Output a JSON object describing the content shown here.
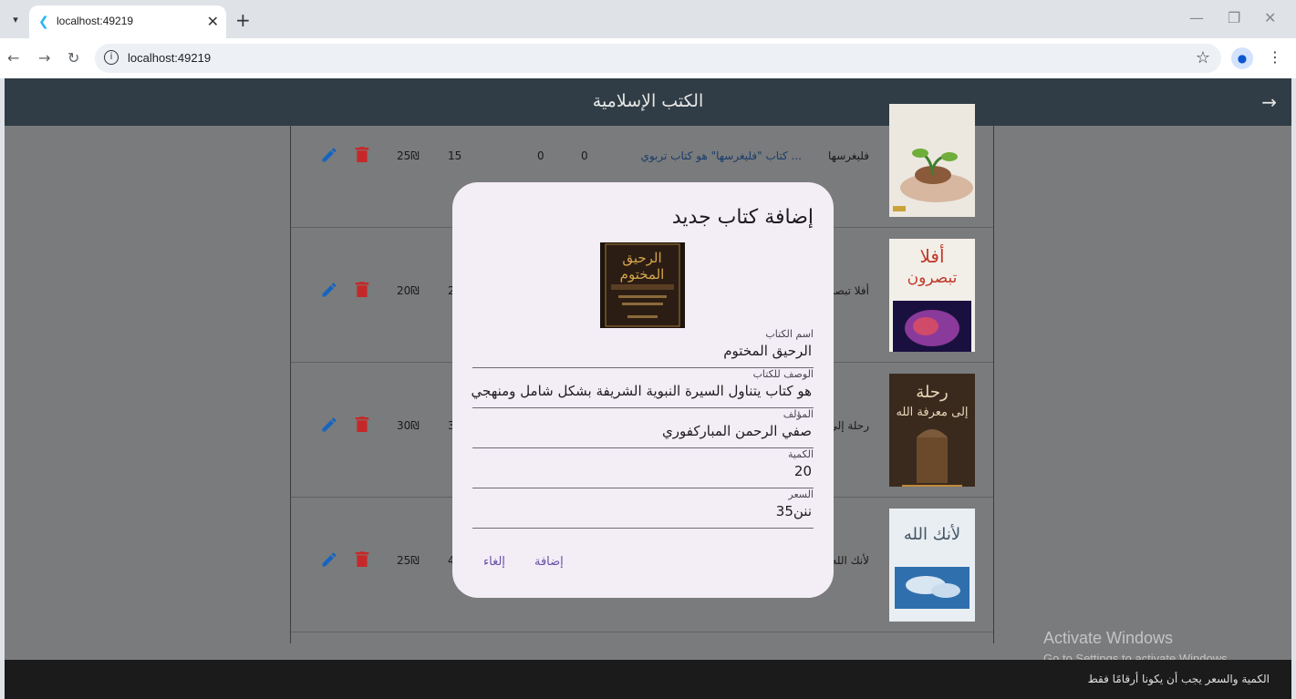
{
  "browser": {
    "tab_title": "localhost:49219",
    "url": "localhost:49219",
    "favicon": "flutter-icon"
  },
  "app": {
    "title": "الكتب الإسلامية",
    "currency": "₪"
  },
  "books": [
    {
      "name": "فليغرسها",
      "description": "كتاب \"فليغرسها\" هو كتاب تربوي ...",
      "c1": "0",
      "c2": "0",
      "quantity": "15",
      "price": "25₪"
    },
    {
      "name": "أفلا تبصر",
      "description": "",
      "c1": "",
      "c2": "",
      "quantity": "2",
      "price": "20₪"
    },
    {
      "name": "رحلة إلى",
      "description": "",
      "c1": "",
      "c2": "",
      "quantity": "3",
      "price": "30₪"
    },
    {
      "name": "لأنك الله",
      "description": "",
      "c1": "",
      "c2": "",
      "quantity": "4",
      "price": "25₪"
    }
  ],
  "dialog": {
    "title": "إضافة كتاب جديد",
    "fields": [
      {
        "label": "اسم الكتاب",
        "value": "الرحيق المختوم"
      },
      {
        "label": "الوصف للكتاب",
        "value": "هو كتاب يتناول السيرة النبوية الشريفة بشكل شامل ومنهجي"
      },
      {
        "label": "المؤلف",
        "value": "صفي الرحمن المباركفوري"
      },
      {
        "label": "الكمية",
        "value": "20"
      },
      {
        "label": "السعر",
        "value": "ننن35"
      }
    ],
    "add_label": "إضافة",
    "cancel_label": "إلغاء"
  },
  "snackbar": "الكمية والسعر يجب أن يكونا أرقامًا فقط",
  "watermark": {
    "line1": "Activate Windows",
    "line2": "Go to Settings to activate Windows."
  },
  "colors": {
    "appbar": "#303d46",
    "overlay": "#7a7b7c",
    "dialog": "#f3edf6",
    "edit": "#1565c0",
    "delete": "#c62828",
    "button": "#6750a4"
  }
}
